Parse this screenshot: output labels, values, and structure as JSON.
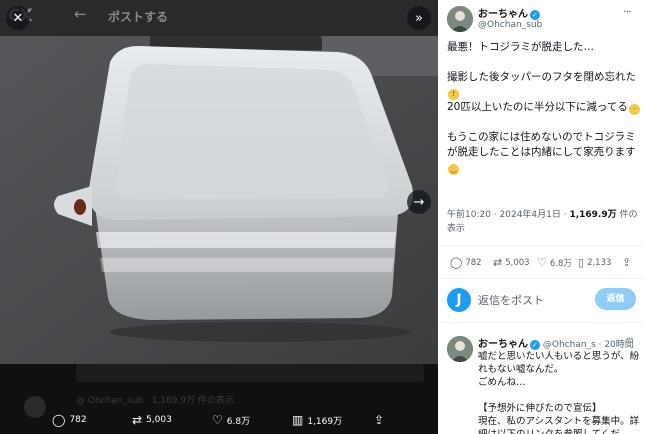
{
  "background_header": {
    "ghost_logo": "CX",
    "back_arrow": "←",
    "ghost_title": "ポストする"
  },
  "viewer": {
    "close_icon": "✕",
    "expand_icon": "»",
    "next_icon": "→"
  },
  "background_lower": {
    "ghost_text": "@ Ohchan_sub · 1,169.9万 件の表示"
  },
  "media_actions": {
    "reply_count": "782",
    "repost_count": "5,003",
    "like_count": "6.8万",
    "view_count": "1,169万"
  },
  "author": {
    "name": "おーちゃん",
    "handle": "@Ohchan_sub",
    "more": "···"
  },
  "tweet": {
    "lines": [
      "最悪！トコジラミが脱走した…",
      "",
      "撮影した後タッパーのフタを閉め忘れた",
      "20匹以上いたのに半分以下に減ってる",
      "",
      "もうこの家には住めないのでトコジラミが脱走したことは内緒にして家売ります"
    ],
    "time": "午前10:20 · 2024年4月1日 · ",
    "views_bold": "1,169.9万",
    "views_suffix": " 件の表示"
  },
  "stats": {
    "replies": "782",
    "reposts": "5,003",
    "likes": "6.8万",
    "bookmarks": "2,133"
  },
  "reply_box": {
    "placeholder": "返信をポスト",
    "button": "返信",
    "avatar_letter": "J"
  },
  "reply": {
    "name": "おーちゃん",
    "handle": "@Ohchan_s",
    "time": "· 20時間",
    "more": "···",
    "line1": "嘘だと思いたい人もいると思うが、紛れもない嘘なんだ。",
    "line2": "ごめんね…",
    "line3": "【予想外に伸びたので宣伝】",
    "line4": "現在、私のアシスタントを募集中。詳細は以下のリンクを参照してくだ"
  },
  "colors": {
    "accent": "#1d9bf0",
    "reply_button": "#8ecdf8",
    "secondary_text": "#536471"
  }
}
